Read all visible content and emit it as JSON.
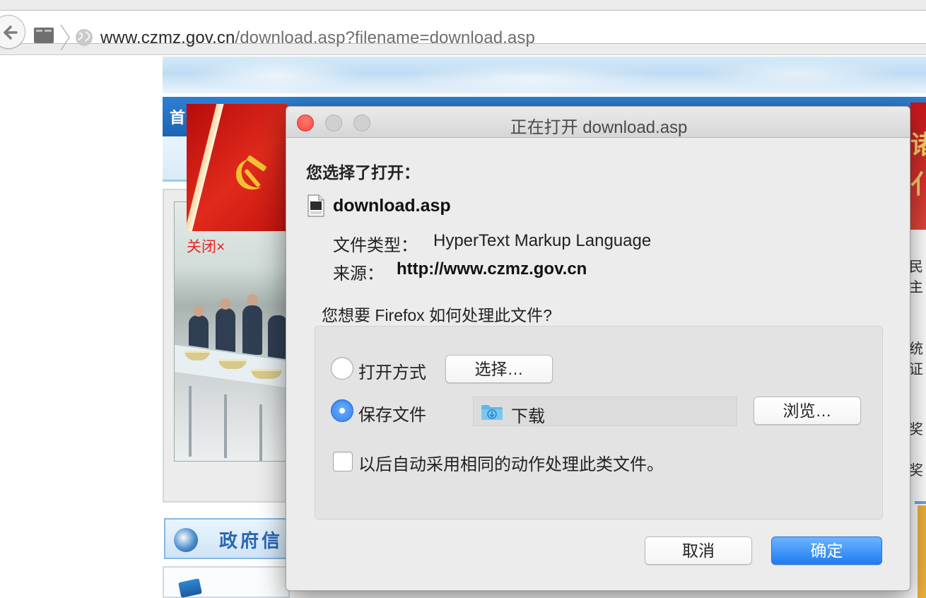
{
  "browser": {
    "url_host": "www.czmz.gov.cn",
    "url_path": "/download.asp?filename=download.asp"
  },
  "page": {
    "nav_first_char": "首",
    "close_link": "关闭×",
    "gov_section_title": "政府信",
    "right_banner_chars": [
      "诸",
      "亻"
    ],
    "right_edge_texts": [
      "民主",
      "统证",
      "奖",
      "奖"
    ]
  },
  "dialog": {
    "title": "正在打开 download.asp",
    "you_chose_label": "您选择了打开：",
    "file_name": "download.asp",
    "file_type_label": "文件类型：",
    "file_type_value": "HyperText Markup Language",
    "source_label": "来源：",
    "source_value": "http://www.czmz.gov.cn",
    "question": "您想要 Firefox 如何处理此文件?",
    "open_with_label": "打开方式",
    "choose_button": "选择…",
    "save_file_label": "保存文件",
    "save_folder": "下载",
    "browse_button": "浏览…",
    "auto_action_label": "以后自动采用相同的动作处理此类文件。",
    "cancel_button": "取消",
    "ok_button": "确定",
    "selected_option": "save-file",
    "auto_action_checked": false
  },
  "colors": {
    "accent": "#1f7cf2",
    "close_red": "#f2463d",
    "close_link_red": "#e12727"
  },
  "icons": [
    "back-arrow-icon",
    "sidebar-icon",
    "chevron-right-icon",
    "globe-icon",
    "file-icon",
    "download-folder-icon",
    "speaker-icon",
    "hammer-sickle-icon"
  ]
}
